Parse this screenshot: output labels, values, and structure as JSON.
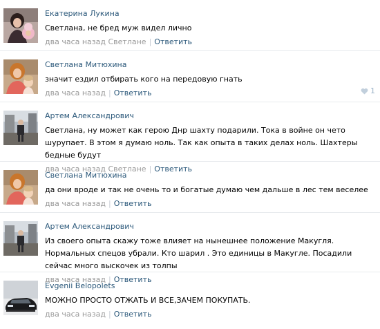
{
  "comments": [
    {
      "author": "Екатерина Лукина",
      "text": "Светлана, не бред муж видел лично",
      "time": "два часа назад",
      "reply_to": "Светлане",
      "reply_label": "Ответить",
      "avatar": "woman-with-child-avatar"
    },
    {
      "author": "Светлана Митюхина",
      "text": "значит ездил отбирать кого на передовую гнать",
      "time": "два часа назад",
      "reply_label": "Ответить",
      "likes": "1",
      "avatar": "woman-with-child-avatar"
    },
    {
      "author": "Артем Александрович",
      "text": "Светлана, ну может как герою Днр шахту подарили. Тока в войне он чето шурупает. В этом я думаю ноль. Так как опыта в таких делах ноль. Шахтеры бедные будут",
      "time": "два часа назад",
      "reply_to": "Светлане",
      "reply_label": "Ответить",
      "avatar": "man-outdoors-avatar"
    },
    {
      "author": "Светлана Митюхина",
      "text": "да они вроде и так не очень то и богатые думаю чем дальше в лес тем веселее",
      "time": "два часа назад",
      "reply_label": "Ответить",
      "avatar": "woman-with-child-avatar"
    },
    {
      "author": "Артем Александрович",
      "text": "Из своего опыта скажу тоже влияет на нынешнее положение Макугля. Нормальных спецов убрали. Кто шарил . Это единицы в Макугле. Посадили сейчас много выскочек из толпы",
      "time": "два часа назад",
      "reply_label": "Ответить",
      "avatar": "man-outdoors-avatar"
    },
    {
      "author": "Evgenii Belopolets",
      "text": "МОЖНО ПРОСТО ОТЖАТЬ И ВСЕ,ЗАЧЕМ ПОКУПАТЬ.",
      "time": "два часа назад",
      "reply_label": "Ответить",
      "avatar": "car-avatar"
    }
  ],
  "colors": {
    "link": "#2b587a",
    "meta": "#999999",
    "divider": "#e7eaed",
    "like": "#9eb4c9"
  },
  "icons": {
    "like": "heart-icon"
  }
}
